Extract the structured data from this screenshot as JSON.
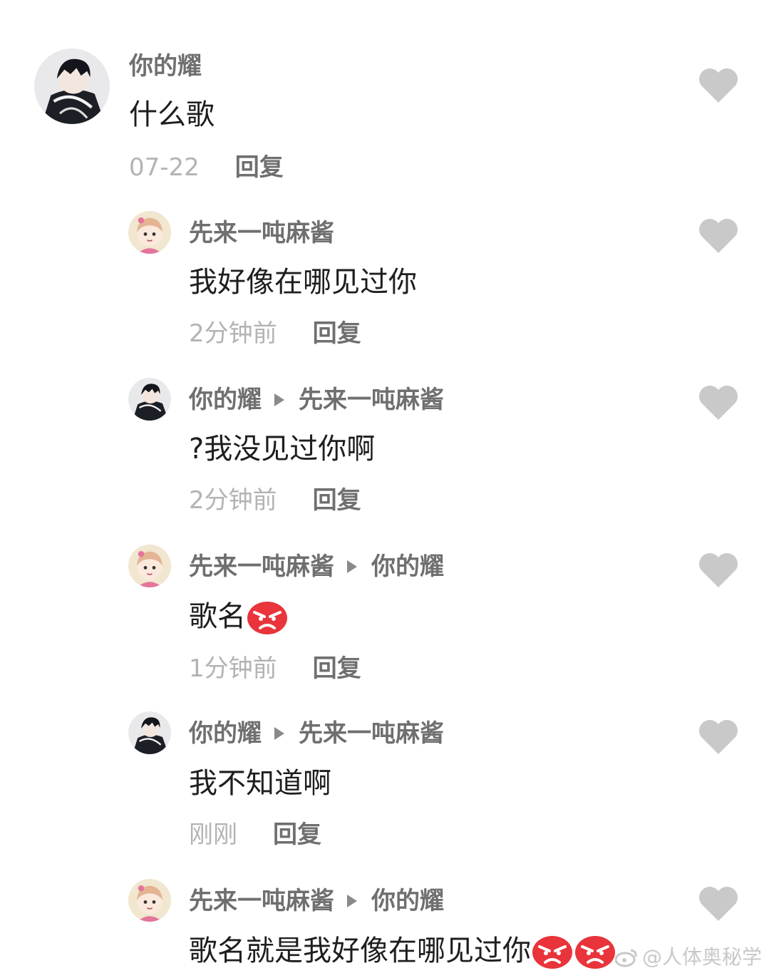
{
  "comments": [
    {
      "author": "你的耀",
      "reply_to": "",
      "text": "什么歌",
      "emoji_count": 0,
      "time": "07-22",
      "reply_label": "回复",
      "avatar": "boy-avatar"
    },
    {
      "author": "先来一吨麻酱",
      "reply_to": "",
      "text": "我好像在哪见过你",
      "emoji_count": 0,
      "time": "2分钟前",
      "reply_label": "回复",
      "avatar": "girl-avatar"
    },
    {
      "author": "你的耀",
      "reply_to": "先来一吨麻酱",
      "text": "?我没见过你啊",
      "emoji_count": 0,
      "time": "2分钟前",
      "reply_label": "回复",
      "avatar": "boy-avatar"
    },
    {
      "author": "先来一吨麻酱",
      "reply_to": "你的耀",
      "text": "歌名",
      "emoji_count": 1,
      "time": "1分钟前",
      "reply_label": "回复",
      "avatar": "girl-avatar"
    },
    {
      "author": "你的耀",
      "reply_to": "先来一吨麻酱",
      "text": "我不知道啊",
      "emoji_count": 0,
      "time": "刚刚",
      "reply_label": "回复",
      "avatar": "boy-avatar"
    },
    {
      "author": "先来一吨麻酱",
      "reply_to": "你的耀",
      "text": "歌名就是我好像在哪见过你",
      "emoji_count": 2,
      "time": "",
      "reply_label": "",
      "avatar": "girl-avatar"
    }
  ],
  "watermark": {
    "text": "@人体奥秘学"
  },
  "icons": {
    "like": "heart-icon",
    "reply_arrow": "triangle-right-icon",
    "emoji": "angry-face-emoji",
    "close": "close-icon"
  },
  "colors": {
    "author": "#6f6f6f",
    "text": "#1e1e1e",
    "time": "#b3b3b3",
    "heart": "#c9c9c9",
    "emoji": "#e8343a"
  }
}
